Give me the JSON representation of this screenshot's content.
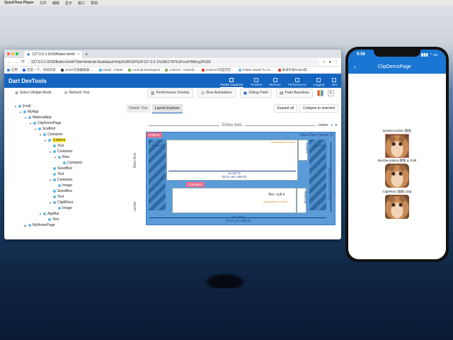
{
  "mac_menu": [
    "QuickTime Player",
    "文件",
    "编辑",
    "显示",
    "窗口",
    "帮助"
  ],
  "browser": {
    "tab_title": "127.0.0.1:9100/flutter.html#/?ide=",
    "tab_close": "×",
    "new_tab": "+",
    "url": "127.0.0.1:9100/flutter.html#/?ide=Android-Studio&uri=http%3A%2F%2F127.0.0.1%3A51787%2Feu4Yl8kIcg2I%3D",
    "bookmarks": [
      "应用",
      "百度一下，你就知道",
      "JSON在线编辑器 -...",
      "install - Flutter",
      "Android Developers",
      "Android - Android...",
      "iconfont-阿里巴巴...",
      "Flutter Model To Ck...",
      "安卓开发Flutter新..."
    ]
  },
  "devtools": {
    "title": "Dart DevTools",
    "tabs": [
      {
        "label": "Flutter Inspector",
        "active": true
      },
      {
        "label": "Timeline",
        "active": false
      },
      {
        "label": "Memory",
        "active": false
      },
      {
        "label": "Performance",
        "active": false
      },
      {
        "label": "Logging",
        "active": false
      },
      {
        "label": "Info",
        "active": false
      }
    ],
    "toolbar": {
      "select_widget": "Select Widget Mode",
      "refresh_tree": "Refresh Tree",
      "performance_overlay": "Performance Overlay",
      "slow_animations": "Slow Animations",
      "debug_paint": "Debug Paint",
      "paint_baselines": "Paint Baselines"
    }
  },
  "widget_tree": [
    {
      "label": "[root]",
      "depth": 0,
      "caret": "▼"
    },
    {
      "label": "MyApp",
      "depth": 1,
      "caret": "▼"
    },
    {
      "label": "MaterialApp",
      "depth": 2,
      "caret": "▼"
    },
    {
      "label": "ClipDemoPage",
      "depth": 3,
      "caret": "▼"
    },
    {
      "label": "Scaffold",
      "depth": 4,
      "caret": "▼"
    },
    {
      "label": "Container",
      "depth": 5,
      "caret": "▼"
    },
    {
      "label": "Column",
      "depth": 6,
      "caret": "▼",
      "selected": true
    },
    {
      "label": "Text",
      "depth": 7,
      "caret": ""
    },
    {
      "label": "Container",
      "depth": 7,
      "caret": "▼"
    },
    {
      "label": "Row",
      "depth": 8,
      "caret": "▼"
    },
    {
      "label": "Container",
      "depth": 9,
      "caret": ""
    },
    {
      "label": "SizedBox",
      "depth": 7,
      "caret": ""
    },
    {
      "label": "Text",
      "depth": 7,
      "caret": ""
    },
    {
      "label": "Container",
      "depth": 7,
      "caret": "▼"
    },
    {
      "label": "Image",
      "depth": 8,
      "caret": ""
    },
    {
      "label": "SizedBox",
      "depth": 7,
      "caret": ""
    },
    {
      "label": "Text",
      "depth": 7,
      "caret": ""
    },
    {
      "label": "ClipRRect",
      "depth": 7,
      "caret": "▼"
    },
    {
      "label": "Image",
      "depth": 8,
      "caret": ""
    },
    {
      "label": "AppBar",
      "depth": 5,
      "caret": "▼"
    },
    {
      "label": "Text",
      "depth": 6,
      "caret": ""
    },
    {
      "label": "MyHomePage",
      "depth": 2,
      "caret": "▶"
    }
  ],
  "layout_explorer": {
    "tabs": [
      "Details Tree",
      "Layout Explorer"
    ],
    "expand_all": "Expand all",
    "collapse": "Collapse to selected",
    "cross_axis": "Cross Axis",
    "cross_align": "center",
    "main_axis": "Main Axis",
    "main_align": "center",
    "total_flex": "Total Flex Factor: 0",
    "column_tag": "Column",
    "container_tag": "Container",
    "w_left": "w=24.5",
    "w_right": "w=24.5",
    "h_top": "h=20.0",
    "w_inner": "w=127.0",
    "w_inner_sub": "(0.0<=w<=394.0)",
    "w_outer": "w=176.0",
    "w_outer_sub": "(0.0<=w<=394.0)",
    "h_right": "h=279.0",
    "h_right_sub": "(0.0<=h<=770.0)",
    "flex_label": "flex: null",
    "unconstrained": "unconstrained vertical",
    "unconstrained_top": "unconstrained vertical",
    "flex_h": "flex(h=0)"
  },
  "phone": {
    "time": "9:56",
    "title": "ClipDemoPage",
    "back": "‹",
    "items": [
      "BoxDecoration 圆角",
      "BoxDecoration 圆角 & child",
      "ClipRRect 圆角 child"
    ]
  }
}
